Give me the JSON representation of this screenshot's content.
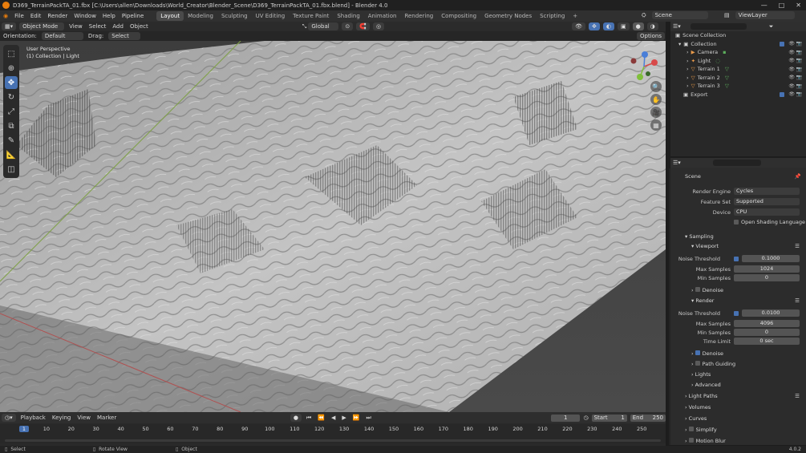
{
  "title": "D369_TerrainPackTA_01.fbx [C:\\Users\\allen\\Downloads\\World_Creator\\Blender_Scene\\D369_TerrainPackTA_01.fbx.blend] - Blender 4.0",
  "menus": [
    "File",
    "Edit",
    "Render",
    "Window",
    "Help",
    "Pipeline"
  ],
  "workspaces": [
    "Layout",
    "Modeling",
    "Sculpting",
    "UV Editing",
    "Texture Paint",
    "Shading",
    "Animation",
    "Rendering",
    "Compositing",
    "Geometry Nodes",
    "Scripting"
  ],
  "active_workspace": "Layout",
  "scene_name": "Scene",
  "view_layer": "ViewLayer",
  "viewport_header": {
    "mode": "Object Mode",
    "view": "View",
    "select": "Select",
    "add": "Add",
    "object": "Object",
    "transform": "Global",
    "options": "Options"
  },
  "tool_header": {
    "orientation_label": "Orientation:",
    "orientation_value": "Default",
    "drag_label": "Drag:",
    "drag_value": "Select Box"
  },
  "viewport_overlay": {
    "perspective": "User Perspective",
    "collection": "(1) Collection | Light"
  },
  "outliner": {
    "root": "Scene Collection",
    "items": [
      {
        "name": "Collection",
        "indent": 1
      },
      {
        "name": "Camera",
        "indent": 2
      },
      {
        "name": "Light",
        "indent": 2
      },
      {
        "name": "Terrain 1",
        "indent": 2
      },
      {
        "name": "Terrain 2",
        "indent": 2
      },
      {
        "name": "Terrain 3",
        "indent": 2
      },
      {
        "name": "Export",
        "indent": 1
      }
    ]
  },
  "properties": {
    "context": "Scene",
    "render_engine_label": "Render Engine",
    "render_engine": "Cycles",
    "feature_set_label": "Feature Set",
    "feature_set": "Supported",
    "device_label": "Device",
    "device": "CPU",
    "osl": "Open Shading Language",
    "sampling": "Sampling",
    "viewport": "Viewport",
    "noise_threshold_label": "Noise Threshold",
    "vp_noise": "0.1000",
    "max_samples_label": "Max Samples",
    "vp_max": "1024",
    "min_samples_label": "Min Samples",
    "vp_min": "0",
    "denoise": "Denoise",
    "render": "Render",
    "r_noise": "0.0100",
    "r_max": "4096",
    "r_min": "0",
    "time_limit_label": "Time Limit",
    "r_time": "0 sec",
    "path_guiding": "Path Guiding",
    "lights": "Lights",
    "advanced": "Advanced",
    "light_paths": "Light Paths",
    "volumes": "Volumes",
    "curves": "Curves",
    "simplify": "Simplify",
    "motion_blur": "Motion Blur"
  },
  "timeline": {
    "playback": "Playback",
    "keying": "Keying",
    "view": "View",
    "marker": "Marker",
    "current_frame": "1",
    "start_label": "Start",
    "start": "1",
    "end_label": "End",
    "end": "250",
    "ticks": [
      "1",
      "10",
      "20",
      "30",
      "40",
      "50",
      "60",
      "70",
      "80",
      "90",
      "100",
      "110",
      "120",
      "130",
      "140",
      "150",
      "160",
      "170",
      "180",
      "190",
      "200",
      "210",
      "220",
      "230",
      "240",
      "250"
    ]
  },
  "statusbar": {
    "select": "Select",
    "rotate": "Rotate View",
    "object": "Object",
    "version": "4.0.2"
  }
}
